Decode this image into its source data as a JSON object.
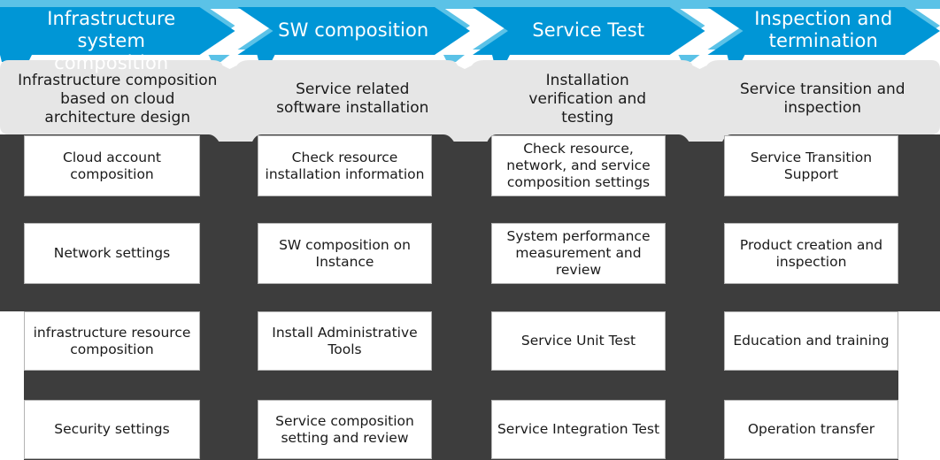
{
  "colors": {
    "chevron_fill": "#0096d6",
    "chevron_top_band": "#5bc2e7",
    "header_band": "#e6e6e6",
    "dark_panel": "#3d3d3d",
    "box_fill": "#ffffff",
    "box_border": "#b3b3b3",
    "chevron_text": "#ffffff",
    "body_text": "#1a1a1a"
  },
  "phases": [
    {
      "id": "infrastructure-system-composition",
      "chevron_label": "Infrastructure system composition",
      "chevron_lines": [
        "Infrastructure system",
        "composition"
      ],
      "header_label": "Infrastructure composition based on cloud architecture design",
      "header_lines": [
        "Infrastructure composition",
        "based on cloud",
        "architecture design"
      ],
      "items": [
        {
          "label": "Cloud account composition",
          "lines": [
            "Cloud account",
            "composition"
          ]
        },
        {
          "label": "Network settings",
          "lines": [
            "Network settings"
          ]
        },
        {
          "label": "infrastructure resource composition",
          "lines": [
            "infrastructure resource",
            "composition"
          ]
        },
        {
          "label": "Security settings",
          "lines": [
            "Security settings"
          ]
        }
      ]
    },
    {
      "id": "sw-composition",
      "chevron_label": "SW composition",
      "chevron_lines": [
        "SW composition"
      ],
      "header_label": "Service related software installation",
      "header_lines": [
        "Service related",
        "software installation"
      ],
      "items": [
        {
          "label": "Check resource installation information",
          "lines": [
            "Check resource",
            "installation information"
          ]
        },
        {
          "label": "SW composition on Instance",
          "lines": [
            "SW composition on",
            "Instance"
          ]
        },
        {
          "label": "Install Administrative Tools",
          "lines": [
            "Install Administrative",
            "Tools"
          ]
        },
        {
          "label": "Service composition setting and review",
          "lines": [
            "Service composition",
            "setting and review"
          ]
        }
      ]
    },
    {
      "id": "service-test",
      "chevron_label": "Service Test",
      "chevron_lines": [
        "Service Test"
      ],
      "header_label": "Installation verification and testing",
      "header_lines": [
        "Installation",
        "verification and",
        "testing"
      ],
      "items": [
        {
          "label": "Check resource, network, and service composition settings",
          "lines": [
            "Check resource,",
            "network, and service",
            "composition settings"
          ]
        },
        {
          "label": "System performance measurement and review",
          "lines": [
            "System performance",
            "measurement and",
            "review"
          ]
        },
        {
          "label": "Service Unit Test",
          "lines": [
            "Service Unit Test"
          ]
        },
        {
          "label": "Service Integration Test",
          "lines": [
            "Service Integration Test"
          ]
        }
      ]
    },
    {
      "id": "inspection-and-termination",
      "chevron_label": "Inspection and termination",
      "chevron_lines": [
        "Inspection and",
        "termination"
      ],
      "header_label": "Service transition and inspection",
      "header_lines": [
        "Service transition and",
        "inspection"
      ],
      "items": [
        {
          "label": "Service Transition Support",
          "lines": [
            "Service Transition",
            "Support"
          ]
        },
        {
          "label": "Product creation and inspection",
          "lines": [
            "Product creation and",
            "inspection"
          ]
        },
        {
          "label": "Education and training",
          "lines": [
            "Education and training"
          ]
        },
        {
          "label": "Operation transfer",
          "lines": [
            "Operation transfer"
          ]
        }
      ]
    }
  ]
}
